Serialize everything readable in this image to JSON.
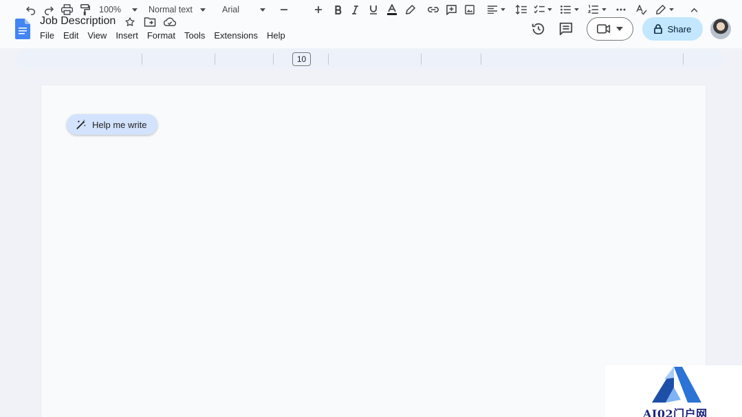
{
  "document": {
    "title": "Job Description"
  },
  "menu": [
    "File",
    "Edit",
    "View",
    "Insert",
    "Format",
    "Tools",
    "Extensions",
    "Help"
  ],
  "header_actions": {
    "share_label": "Share"
  },
  "toolbar": {
    "zoom": "100%",
    "style": "Normal text",
    "font": "Arial",
    "font_size": "10"
  },
  "page": {
    "help_me_write_label": "Help me write"
  },
  "watermark": {
    "text": "AI02门户网"
  },
  "colors": {
    "accent_blue": "#1a73e8",
    "share_bg": "#c2e7ff",
    "chip_bg": "#d3e3fd"
  }
}
